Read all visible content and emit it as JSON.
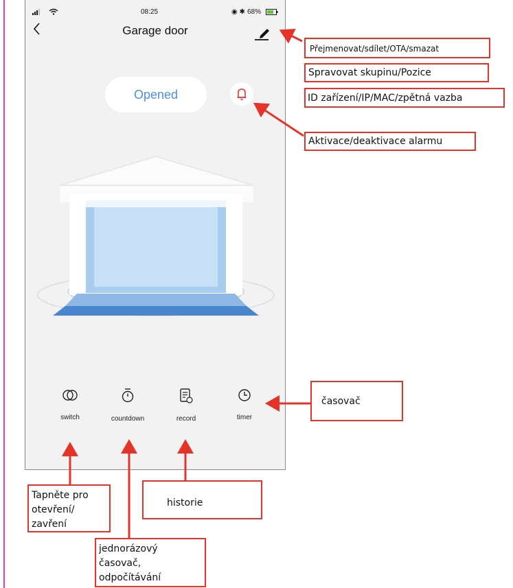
{
  "status_bar": {
    "signal_icon": "signal-icon",
    "wifi_icon": "wifi-icon",
    "time": "08:25",
    "battery": "68%"
  },
  "nav": {
    "title": "Garage door",
    "back_icon": "chevron-left-icon",
    "edit_icon": "edit-icon"
  },
  "state": {
    "door_status": "Opened",
    "alarm_icon": "bell-icon"
  },
  "controls": [
    {
      "label": "switch",
      "icon": "switch-icon"
    },
    {
      "label": "countdown",
      "icon": "stopwatch-icon"
    },
    {
      "label": "record",
      "icon": "record-icon"
    },
    {
      "label": "timer",
      "icon": "clock-icon"
    }
  ],
  "annotations": {
    "edit_menu": "Přejmenovat/sdílet/OTA/smazat",
    "manage_group": "Spravovat skupinu/Pozice",
    "device_info": "ID zařízení/IP/MAC/zpětná vazba",
    "alarm": "Aktivace/deaktivace alarmu",
    "timer": "časovač",
    "switch": "Tapněte pro otevření/ zavření",
    "record": "historie",
    "countdown": "jednorázový časovač, odpočítávání"
  },
  "colors": {
    "accent": "#4a90d9",
    "alarm": "#e6332a",
    "annotation": "#e6332a",
    "door_glass": "#b8d8f2",
    "floor": "#4a86cc"
  }
}
